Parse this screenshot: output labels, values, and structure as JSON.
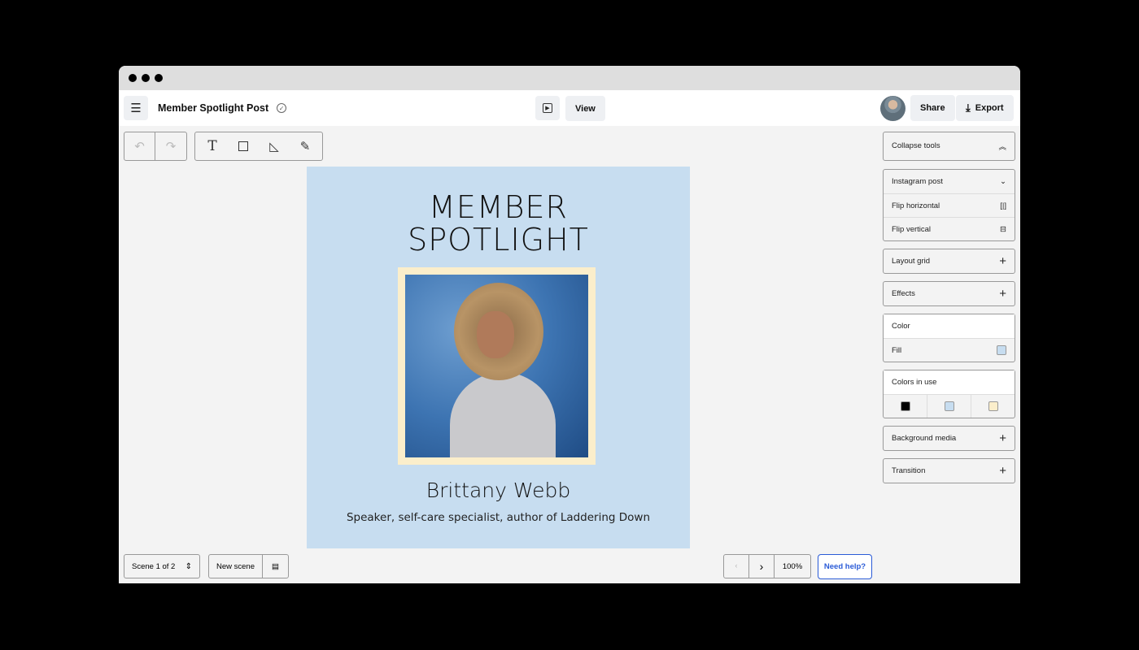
{
  "header": {
    "menu_icon": "hamburger-icon",
    "title": "Member Spotlight Post",
    "saved_icon": "check-circle-icon",
    "preview_icon": "play-icon",
    "view_label": "View",
    "share_label": "Share",
    "export_label": "Export"
  },
  "toolbar": {
    "undo": "undo-icon",
    "redo": "redo-icon",
    "tools": [
      "text-icon",
      "image-icon",
      "shape-icon",
      "pen-icon"
    ]
  },
  "artboard": {
    "heading_line1": "MEMBER",
    "heading_line2": "SPOTLIGHT",
    "name": "Brittany Webb",
    "subtitle": "Speaker, self-care specialist, author of Laddering Down",
    "bg_color": "#c7ddf0",
    "frame_color": "#fbeecb"
  },
  "panel": {
    "collapse": "Collapse tools",
    "format": "Instagram post",
    "flip_h": "Flip horizontal",
    "flip_v": "Flip vertical",
    "layout_grid": "Layout grid",
    "effects": "Effects",
    "color": "Color",
    "fill": "Fill",
    "fill_color": "#c7ddf0",
    "colors_in_use": "Colors in use",
    "colors": [
      "#000000",
      "#c7ddf0",
      "#fbeecb"
    ],
    "background_media": "Background media",
    "transition": "Transition"
  },
  "footer": {
    "scene": "Scene 1 of 2",
    "new_scene": "New scene",
    "zoom": "100%",
    "help": "Need help?"
  }
}
